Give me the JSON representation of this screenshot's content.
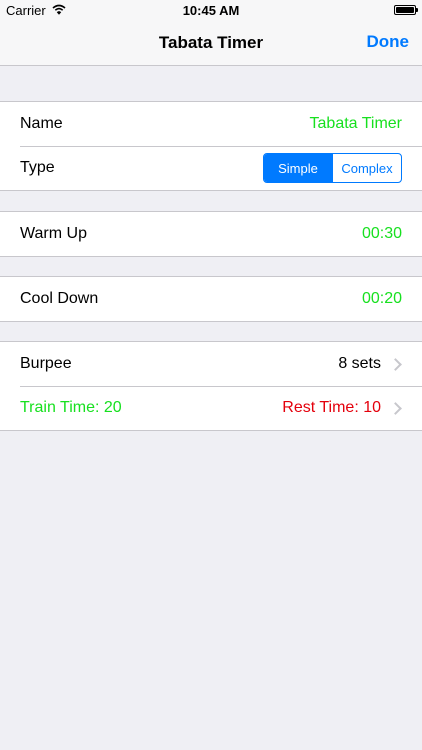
{
  "status_bar": {
    "carrier": "Carrier",
    "time": "10:45 AM"
  },
  "nav": {
    "title": "Tabata Timer",
    "done_label": "Done"
  },
  "settings": {
    "name_label": "Name",
    "name_value": "Tabata Timer",
    "type_label": "Type",
    "type_options": [
      "Simple",
      "Complex"
    ],
    "type_selected": "Simple"
  },
  "warm_up": {
    "label": "Warm Up",
    "value": "00:30"
  },
  "cool_down": {
    "label": "Cool Down",
    "value": "00:20"
  },
  "exercise": {
    "name": "Burpee",
    "sets": "8 sets",
    "train_time": "Train Time: 20",
    "rest_time": "Rest Time: 10"
  },
  "colors": {
    "accent": "#007aff",
    "green": "#17e01f",
    "red": "#e4000c",
    "background": "#efeff4"
  }
}
